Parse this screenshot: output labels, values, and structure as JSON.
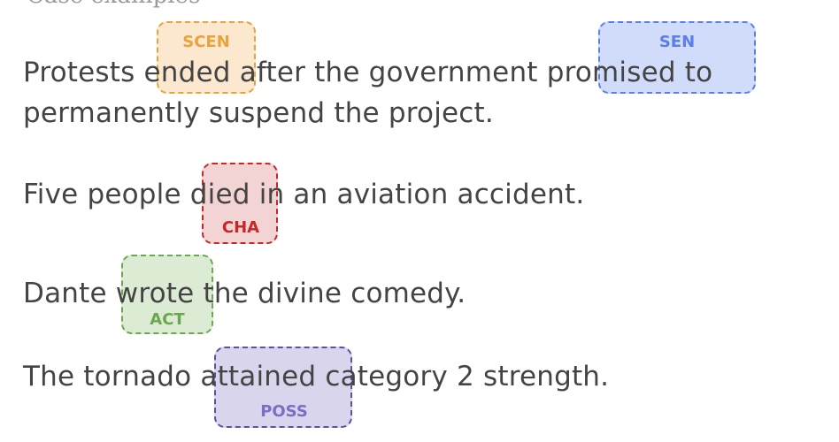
{
  "heading_fragment": "Case examples",
  "colors": {
    "scen": {
      "border": "#e8a33d",
      "fill": "#fbe8cf",
      "text": "#e8a33d"
    },
    "sen": {
      "border": "#5b7fe6",
      "fill": "#d1dcfa",
      "text": "#5b7fe6"
    },
    "cha": {
      "border": "#c62828",
      "fill": "#f3d4d4",
      "text": "#c62828"
    },
    "act": {
      "border": "#6aa84f",
      "fill": "#dcebd3",
      "text": "#6aa84f"
    },
    "poss": {
      "border": "#5e4fa2",
      "fill": "#d9d5ec",
      "text": "#7b6fc4"
    }
  },
  "examples": [
    {
      "line1": [
        "Protests ",
        "ended",
        " after the government ",
        "promised",
        " to"
      ],
      "line2": "permanently suspend the project.",
      "tags": [
        {
          "word": "ended",
          "label": "SCEN"
        },
        {
          "word": "promised",
          "label": "SEN"
        }
      ]
    },
    {
      "parts": [
        "Five people ",
        "died",
        " in an aviation accident."
      ],
      "tags": [
        {
          "word": "died",
          "label": "CHA"
        }
      ]
    },
    {
      "parts": [
        "Dante ",
        "wrote",
        " the divine comedy."
      ],
      "tags": [
        {
          "word": "wrote",
          "label": "ACT"
        }
      ]
    },
    {
      "parts": [
        "The tornado ",
        "attained",
        " category 2 strength."
      ],
      "tags": [
        {
          "word": "attained",
          "label": "POSS"
        }
      ]
    }
  ]
}
